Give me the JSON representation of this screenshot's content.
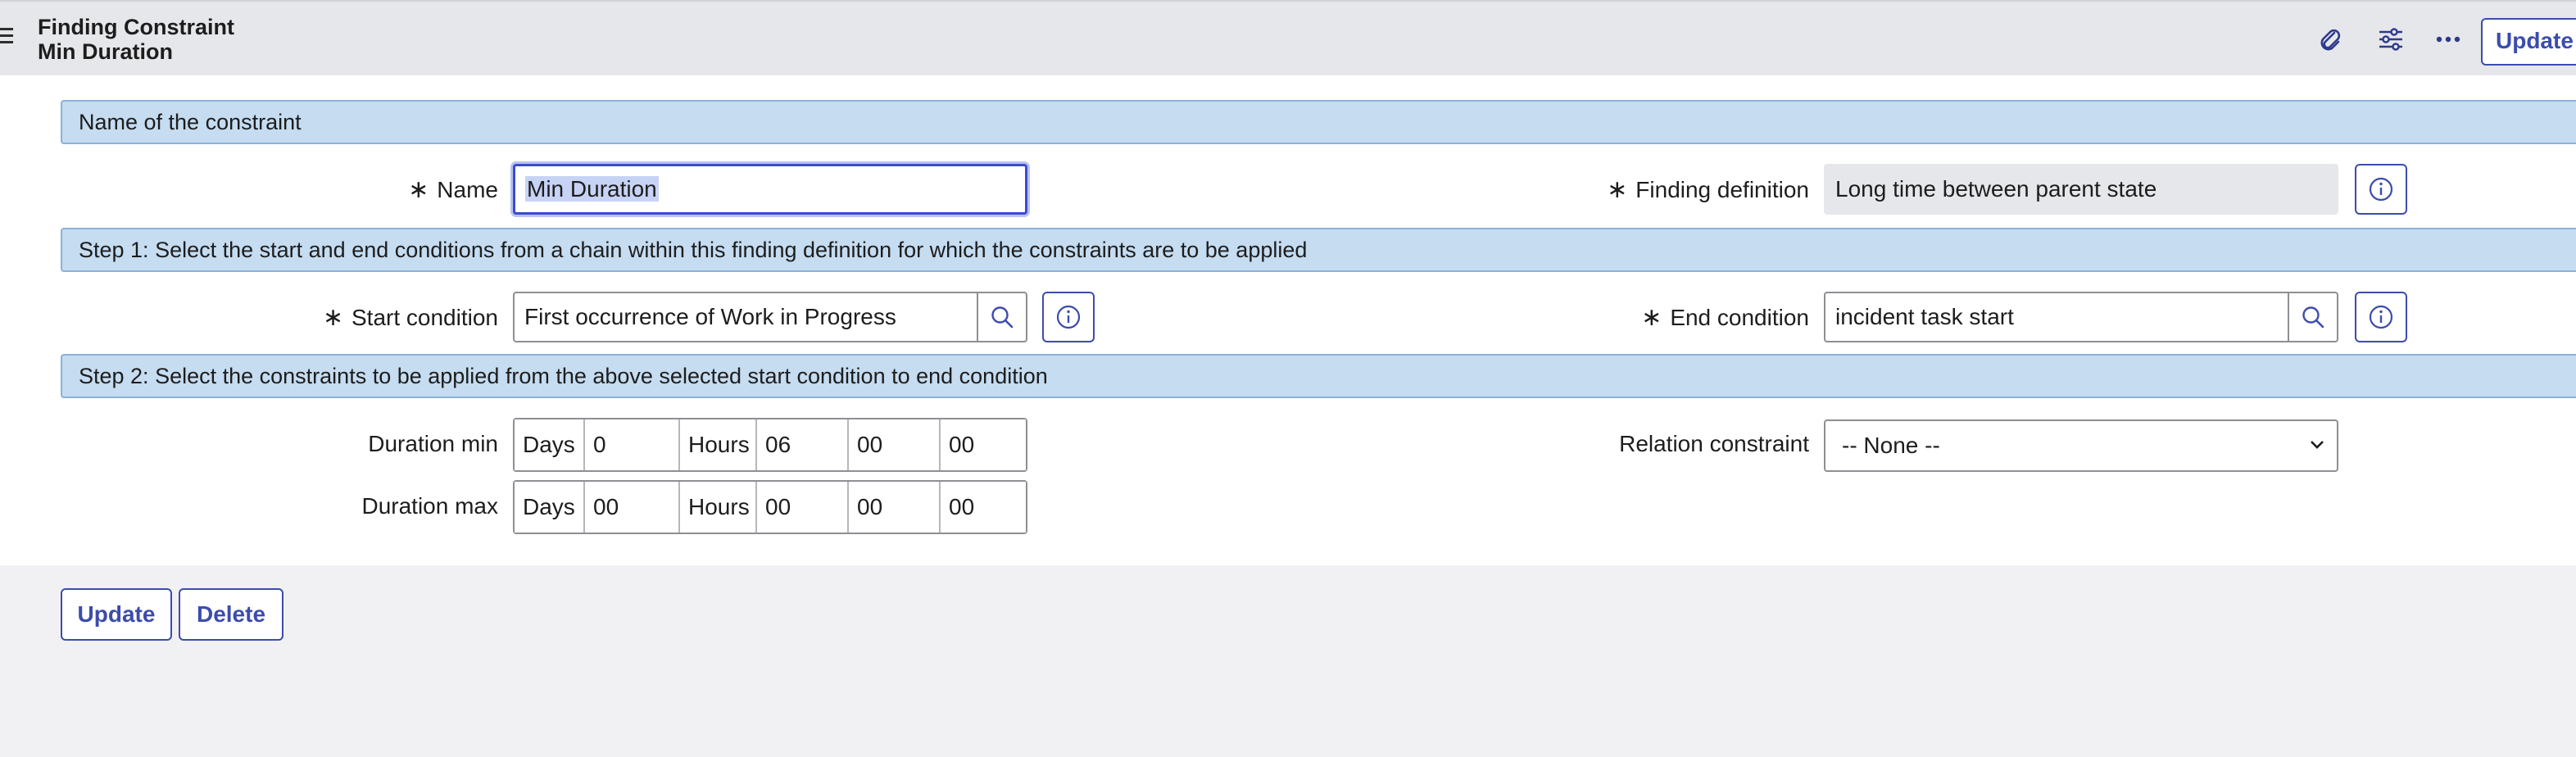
{
  "header": {
    "title_line1": "Finding Constraint",
    "title_line2": "Min Duration",
    "icons": [
      "menu-icon",
      "paperclip-icon",
      "sliders-icon",
      "more-icon"
    ],
    "update_label": "Update"
  },
  "sections": {
    "name": "Name of the constraint",
    "step1": "Step 1: Select the start and end conditions from a chain within this finding definition for which the constraints are to be applied",
    "step2": "Step 2: Select the constraints to be applied from the above selected start condition to end condition"
  },
  "fields": {
    "required_mark": "∗",
    "name_label": "Name",
    "name_value": "Min Duration",
    "finding_label": "Finding definition",
    "finding_value": "Long time between parent state",
    "start_label": "Start condition",
    "start_value": "First occurrence of Work in Progress",
    "end_label": "End condition",
    "end_value": "incident task start",
    "duration_min_label": "Duration min",
    "duration_max_label": "Duration max",
    "days_label": "Days",
    "hours_label": "Hours",
    "duration_min": {
      "days": "0",
      "hours": "06",
      "minutes": "00",
      "seconds": "00"
    },
    "duration_max": {
      "days": "00",
      "hours": "00",
      "minutes": "00",
      "seconds": "00"
    },
    "relation_label": "Relation constraint",
    "relation_value": "-- None --"
  },
  "buttons": {
    "update": "Update",
    "delete": "Delete"
  },
  "colors": {
    "accent": "#3c4cad",
    "section_bg": "#c5dcf1",
    "header_bg": "#e6e7ea"
  }
}
